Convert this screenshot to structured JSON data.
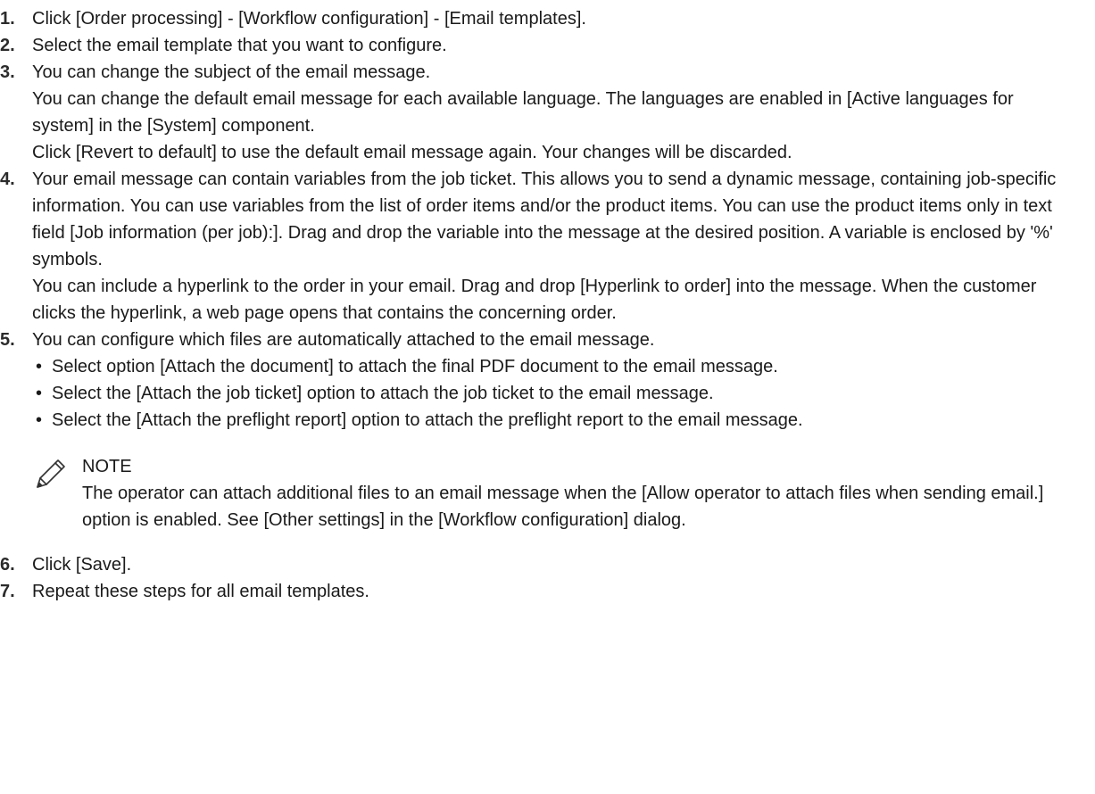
{
  "steps": [
    {
      "number": "1.",
      "paragraphs": [
        "Click [Order processing] - [Workflow configuration] - [Email templates]."
      ]
    },
    {
      "number": "2.",
      "paragraphs": [
        "Select the email template that you want to configure."
      ]
    },
    {
      "number": "3.",
      "paragraphs": [
        "You can change the subject of the email message.",
        "You can change the default email message for each available language. The languages are enabled in [Active languages for system] in the [System] component.",
        "Click [Revert to default] to use the default email message again. Your changes will be discarded."
      ]
    },
    {
      "number": "4.",
      "paragraphs": [
        "Your email message can contain variables from the job ticket. This allows you to send a dynamic message, containing job-specific information. You can use variables from the list of order items and/or the product items. You can use the product items only in text field [Job information (per job):]. Drag and drop the variable into the message at the desired position. A variable is enclosed by '%' symbols.",
        "You can include a hyperlink to the order in your email. Drag and drop [Hyperlink to order] into the message. When the customer clicks the hyperlink, a web page opens that contains the concerning order."
      ]
    },
    {
      "number": "5.",
      "paragraphs": [
        "You can configure which files are automatically attached to the email message."
      ],
      "bullets": [
        "Select option [Attach the document] to attach the final PDF document to the email message.",
        "Select the [Attach the job ticket] option to attach the job ticket to the email message.",
        "Select the [Attach the preflight report] option to attach the preflight report to the email message."
      ],
      "note": {
        "icon": "pencil-note-icon",
        "title": "NOTE",
        "text": "The operator can attach additional files to an email message when the [Allow operator to attach files when sending email.] option is enabled. See [Other settings] in the [Workflow configuration] dialog."
      }
    },
    {
      "number": "6.",
      "paragraphs": [
        "Click [Save]."
      ]
    },
    {
      "number": "7.",
      "paragraphs": [
        "Repeat these steps for all email templates."
      ]
    }
  ],
  "bullet_symbol": "•"
}
